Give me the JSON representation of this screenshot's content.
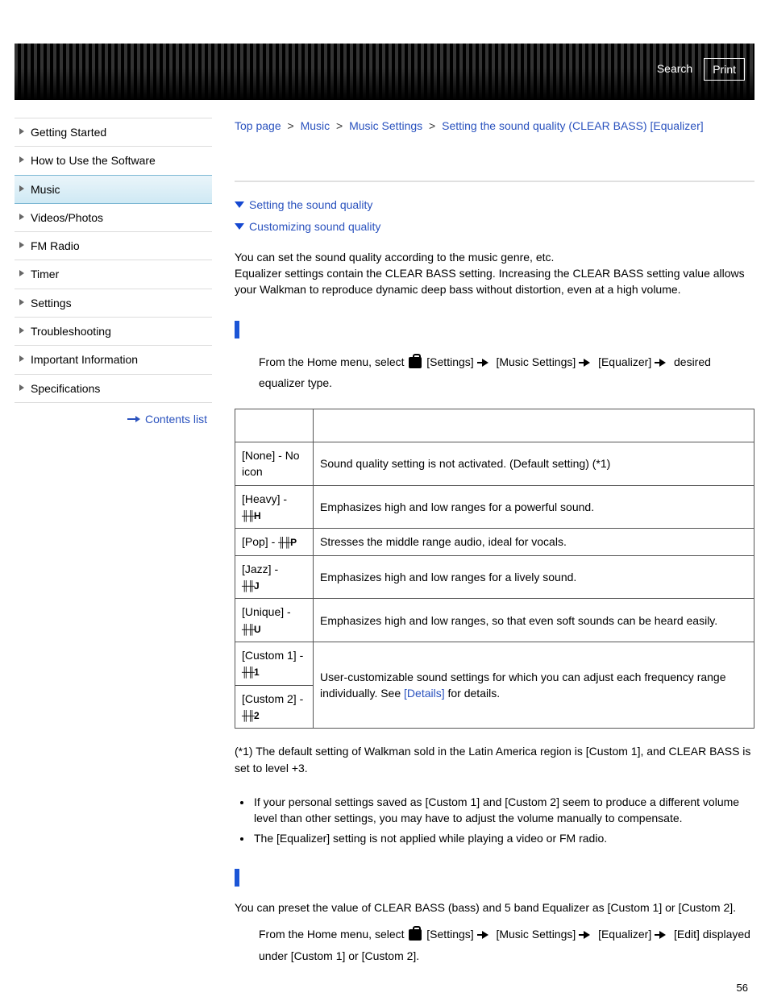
{
  "header": {
    "search": "Search",
    "print": "Print"
  },
  "breadcrumb": {
    "items": [
      "Top page",
      "Music",
      "Music Settings"
    ],
    "current": "Setting the sound quality (CLEAR BASS) [Equalizer]",
    "sep": ">"
  },
  "sidebar": {
    "items": [
      {
        "label": "Getting Started"
      },
      {
        "label": "How to Use the Software"
      },
      {
        "label": "Music",
        "active": true
      },
      {
        "label": "Videos/Photos"
      },
      {
        "label": "FM Radio"
      },
      {
        "label": "Timer"
      },
      {
        "label": "Settings"
      },
      {
        "label": "Troubleshooting"
      },
      {
        "label": "Important Information"
      },
      {
        "label": "Specifications"
      }
    ],
    "contents_link": "Contents list"
  },
  "jumps": [
    "Setting the sound quality",
    "Customizing sound quality"
  ],
  "intro": {
    "p1": "You can set the sound quality according to the music genre, etc.",
    "p2": "Equalizer settings contain the CLEAR BASS setting. Increasing the CLEAR BASS setting value allows your Walkman to reproduce dynamic deep bass without distortion, even at a high volume."
  },
  "step1": {
    "prefix": "From the Home menu, select ",
    "settings": "[Settings]",
    "music_settings": "[Music Settings]",
    "equalizer": "[Equalizer]",
    "tail": "desired equalizer type."
  },
  "table": {
    "rows": [
      {
        "type": "[None] - No icon",
        "desc": "Sound quality setting is not activated. (Default setting) (*1)"
      },
      {
        "type": "[Heavy] -",
        "icon": "H",
        "desc": "Emphasizes high and low ranges for a powerful sound."
      },
      {
        "type": "[Pop] -",
        "icon": "P",
        "desc": "Stresses the middle range audio, ideal for vocals."
      },
      {
        "type": "[Jazz] -",
        "icon": "J",
        "desc": "Emphasizes high and low ranges for a lively sound."
      },
      {
        "type": "[Unique] -",
        "icon": "U",
        "desc": "Emphasizes high and low ranges, so that even soft sounds can be heard easily."
      },
      {
        "type": "[Custom 1] -",
        "icon": "1"
      },
      {
        "type": "[Custom 2] -",
        "icon": "2"
      }
    ],
    "custom_desc_pre": "User-customizable sound settings for which you can adjust each frequency range individually. See ",
    "custom_desc_link": "[Details]",
    "custom_desc_post": " for details."
  },
  "footnote": "(*1) The default setting of Walkman sold in the Latin America region is [Custom 1], and CLEAR BASS is set to level +3.",
  "notes": [
    "If your personal settings saved as [Custom 1] and [Custom 2] seem to produce a different volume level than other settings, you may have to adjust the volume manually to compensate.",
    "The [Equalizer] setting is not applied while playing a video or FM radio."
  ],
  "custom_section": {
    "p": "You can preset the value of CLEAR BASS (bass) and 5 band Equalizer as [Custom 1] or [Custom 2].",
    "step_prefix": "From the Home menu, select ",
    "settings": "[Settings]",
    "music_settings": "[Music Settings]",
    "equalizer": "[Equalizer]",
    "edit": "[Edit]",
    "tail": "displayed under [Custom 1] or [Custom 2]."
  },
  "page_number": "56"
}
